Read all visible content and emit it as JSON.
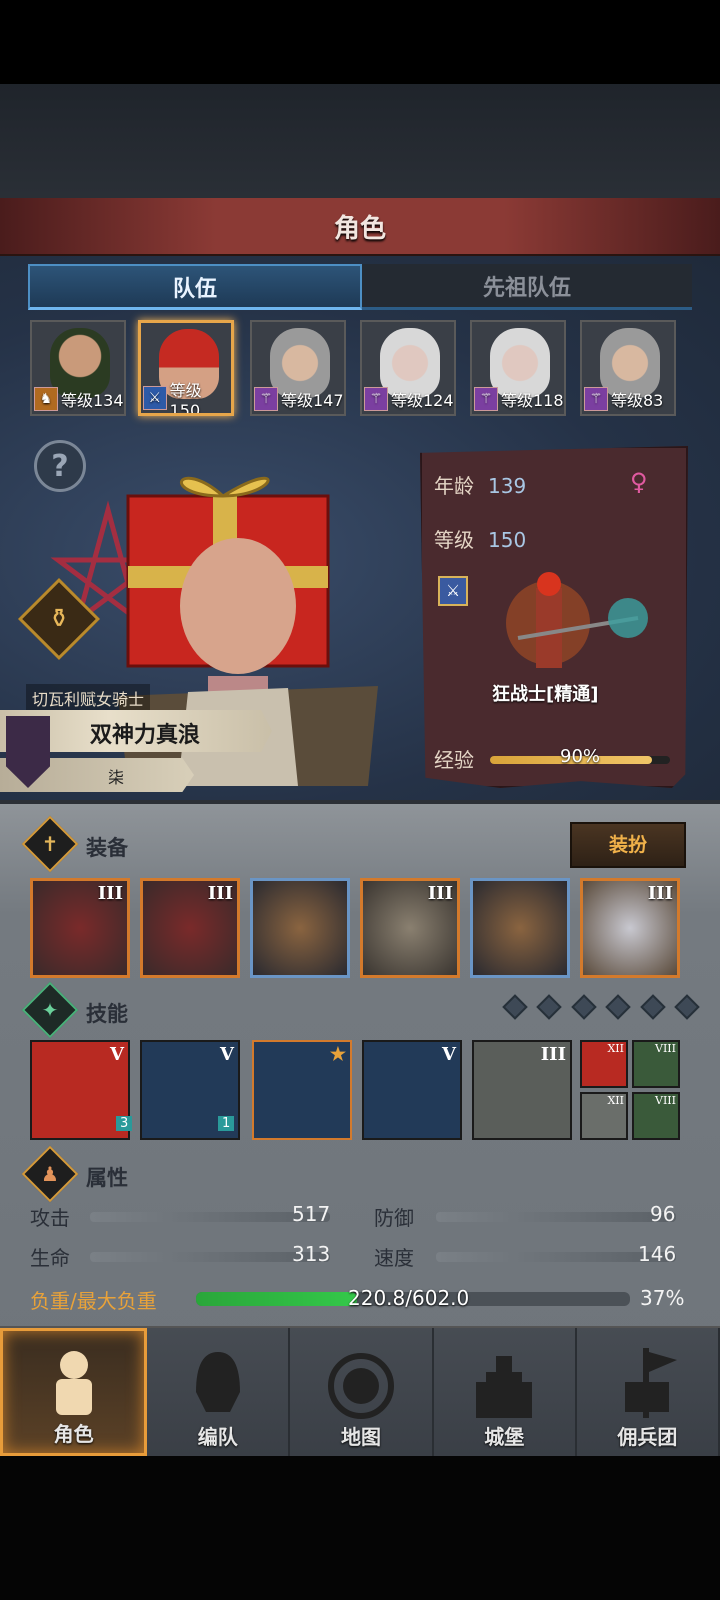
{
  "header": {
    "title": "角色"
  },
  "tabs": [
    {
      "label": "队伍",
      "active": true
    },
    {
      "label": "先祖队伍",
      "active": false
    }
  ],
  "roster": [
    {
      "level_text": "等级134",
      "selected": false,
      "icon": "horse-icon"
    },
    {
      "level_text": "等级150",
      "selected": true,
      "icon": "sword-icon"
    },
    {
      "level_text": "等级147",
      "selected": false,
      "icon": "staff-icon"
    },
    {
      "level_text": "等级124",
      "selected": false,
      "icon": "staff-icon"
    },
    {
      "level_text": "等级118",
      "selected": false,
      "icon": "staff-icon"
    },
    {
      "level_text": "等级83",
      "selected": false,
      "icon": "staff-icon"
    }
  ],
  "hero": {
    "class_title": "切瓦利赋女骑士",
    "name": "双神力真浪",
    "rank_label": "柒"
  },
  "info": {
    "age_label": "年龄",
    "age_value": "139",
    "level_label": "等级",
    "level_value": "150",
    "class_name": "狂战士[精通]",
    "exp_label": "经验",
    "exp_value": "90%",
    "exp_fraction": 0.9
  },
  "equipment": {
    "title": "装备",
    "dress_button": "装扮",
    "slots": [
      {
        "name": "weapon-main",
        "rank": "III",
        "border": "orange"
      },
      {
        "name": "weapon-off",
        "rank": "III",
        "border": "orange"
      },
      {
        "name": "helmet",
        "rank": "",
        "border": "blue"
      },
      {
        "name": "armor",
        "rank": "III",
        "border": "orange"
      },
      {
        "name": "boots",
        "rank": "",
        "border": "blue"
      },
      {
        "name": "ring",
        "rank": "III",
        "border": "orange"
      }
    ]
  },
  "skills": {
    "title": "技能",
    "items": [
      {
        "rank": "V",
        "badge": "3"
      },
      {
        "rank": "V",
        "badge": "1"
      },
      {
        "rank": "",
        "badge": ""
      },
      {
        "rank": "V",
        "badge": ""
      },
      {
        "rank": "III",
        "badge": ""
      }
    ],
    "passives": [
      {
        "rank": "XII"
      },
      {
        "rank": "VIII"
      },
      {
        "rank": "XII"
      },
      {
        "rank": "VIII"
      }
    ]
  },
  "attributes": {
    "title": "属性",
    "attack_label": "攻击",
    "attack_value": "517",
    "defense_label": "防御",
    "defense_value": "96",
    "hp_label": "生命",
    "hp_value": "313",
    "speed_label": "速度",
    "speed_value": "146",
    "load_label": "负重/最大负重",
    "load_value": "220.8/602.0",
    "load_percent": "37%",
    "load_fraction": 0.37
  },
  "nav": [
    {
      "label": "角色",
      "active": true
    },
    {
      "label": "编队",
      "active": false
    },
    {
      "label": "地图",
      "active": false
    },
    {
      "label": "城堡",
      "active": false
    },
    {
      "label": "佣兵团",
      "active": false
    }
  ],
  "colors": {
    "accent_orange": "#e89c3a",
    "tab_blue": "#4d8fc4",
    "load_green": "#2aa63a"
  }
}
